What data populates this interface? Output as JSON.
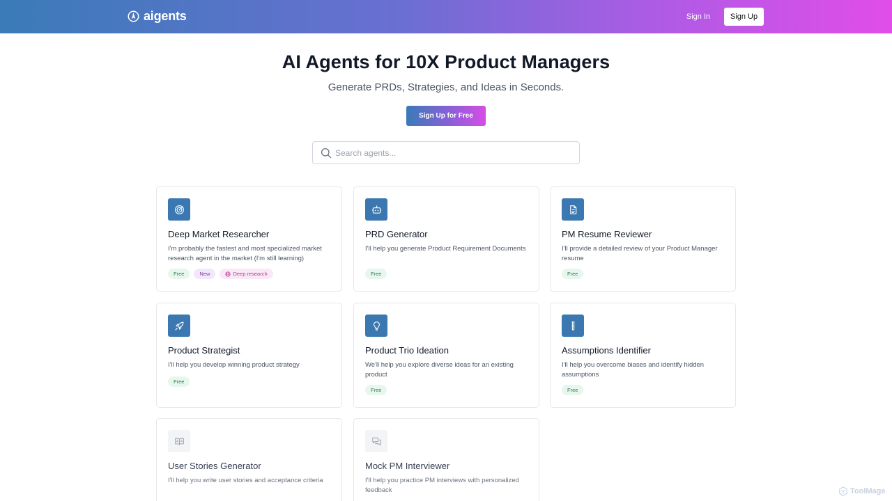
{
  "header": {
    "logo_text": "aigents",
    "signin_label": "Sign In",
    "signup_label": "Sign Up"
  },
  "hero": {
    "title": "AI Agents for 10X Product Managers",
    "subtitle": "Generate PRDs, Strategies, and Ideas in Seconds.",
    "cta_label": "Sign Up for Free"
  },
  "search": {
    "placeholder": "Search agents..."
  },
  "agents": [
    {
      "icon": "radar-target-icon",
      "title": "Deep Market Researcher",
      "description": "I'm probably the fastest and most specialized market research agent in the market (I'm still learning)",
      "badges": {
        "free": "Free",
        "new": "New",
        "deep": "Deep research"
      }
    },
    {
      "icon": "robot-icon",
      "title": "PRD Generator",
      "description": "I'll help you generate Product Requirement Documents",
      "badges": {
        "free": "Free"
      }
    },
    {
      "icon": "document-icon",
      "title": "PM Resume Reviewer",
      "description": "I'll provide a detailed review of your Product Manager resume",
      "badges": {
        "free": "Free"
      }
    },
    {
      "icon": "rocket-icon",
      "title": "Product Strategist",
      "description": "I'll help you develop winning product strategy",
      "badges": {
        "free": "Free"
      }
    },
    {
      "icon": "lightbulb-icon",
      "title": "Product Trio Ideation",
      "description": "We'll help you explore diverse ideas for an existing product",
      "badges": {
        "free": "Free"
      }
    },
    {
      "icon": "test-tube-icon",
      "title": "Assumptions Identifier",
      "description": "I'll help you overcome biases and identify hidden assumptions",
      "badges": {
        "free": "Free"
      }
    },
    {
      "icon": "book-open-icon",
      "title": "User Stories Generator",
      "description": "I'll help you write user stories and acceptance criteria"
    },
    {
      "icon": "chat-bubbles-icon",
      "title": "Mock PM Interviewer",
      "description": "I'll help you practice PM interviews with personalized feedback"
    }
  ],
  "watermark": "ToolMage",
  "colors": {
    "accent": "#3b78b1",
    "gradient_start": "#3a7bb8",
    "gradient_end": "#e14de8",
    "free_badge_bg": "#e7f7ee",
    "free_badge_text": "#2f7a4c"
  }
}
